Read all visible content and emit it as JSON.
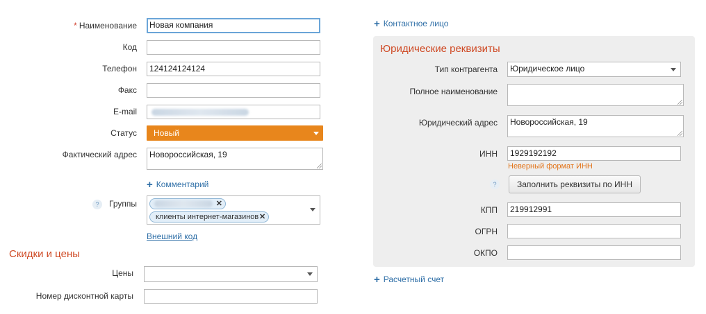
{
  "left": {
    "name": {
      "label": "Наименование",
      "required_mark": "*",
      "value": "Новая компания"
    },
    "code": {
      "label": "Код",
      "value": ""
    },
    "phone": {
      "label": "Телефон",
      "value": "124124124124"
    },
    "fax": {
      "label": "Факс",
      "value": ""
    },
    "email": {
      "label": "E-mail",
      "value": ""
    },
    "status": {
      "label": "Статус",
      "value": "Новый",
      "color": "#e8861c"
    },
    "address": {
      "label": "Фактический адрес",
      "value": "Новороссийская, 19"
    },
    "comment_link": "Комментарий",
    "groups": {
      "label": "Группы",
      "help": "?",
      "tags": [
        "",
        "клиенты интернет-магазинов"
      ]
    },
    "external_code_link": "Внешний код",
    "discounts": {
      "title": "Скидки и цены",
      "prices_label": "Цены",
      "prices_value": "",
      "card_label": "Номер дисконтной карты",
      "card_value": ""
    }
  },
  "right": {
    "contact_link": "Контактное лицо",
    "legal": {
      "title": "Юридические реквизиты",
      "type_label": "Тип контрагента",
      "type_value": "Юридическое лицо",
      "full_name_label": "Полное наименование",
      "full_name_value": "",
      "legal_address_label": "Юридический адрес",
      "legal_address_value": "Новороссийская, 19",
      "inn_label": "ИНН",
      "inn_value": "1929192192",
      "inn_error": "Неверный формат ИНН",
      "help": "?",
      "fill_button": "Заполнить реквизиты по ИНН",
      "kpp_label": "КПП",
      "kpp_value": "219912991",
      "ogrn_label": "ОГРН",
      "ogrn_value": "",
      "okpo_label": "ОКПО",
      "okpo_value": ""
    },
    "bank_account_link": "Расчетный счет"
  },
  "colors": {
    "accent": "#e8861c",
    "link": "#2f6fa7",
    "section_title": "#cf4a25",
    "error": "#e2741a"
  }
}
